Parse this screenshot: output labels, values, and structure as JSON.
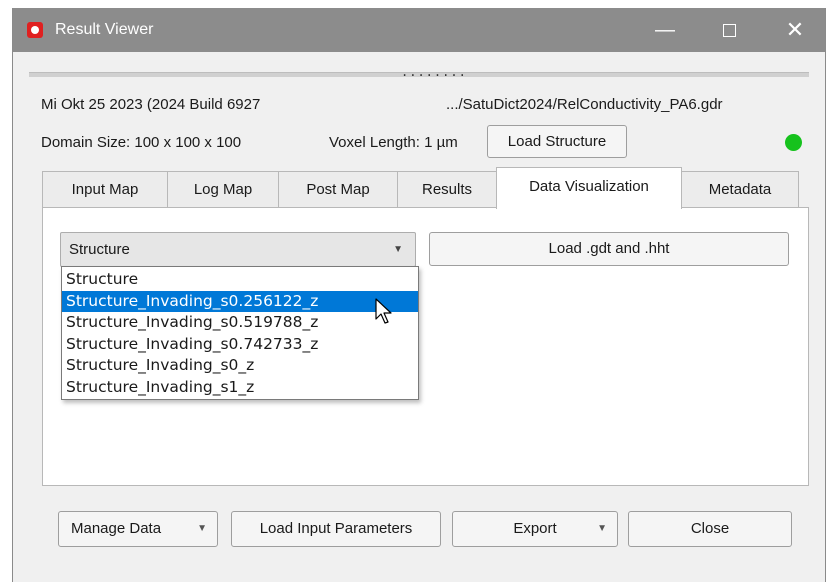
{
  "window": {
    "title": "Result Viewer",
    "controls": {
      "minimize": "—",
      "close": "✕"
    }
  },
  "info": {
    "build": "Mi Okt 25 2023 (2024 Build 6927",
    "file_path": ".../SatuDict2024/RelConductivity_PA6.gdr",
    "domain_size": "Domain Size: 100 x 100 x 100",
    "voxel_length": "Voxel Length: 1 µm",
    "load_structure_label": "Load Structure",
    "status_color": "#16c21d",
    "splitter_dots": "........"
  },
  "tabs": [
    {
      "label": "Input Map",
      "active": false
    },
    {
      "label": "Log Map",
      "active": false
    },
    {
      "label": "Post Map",
      "active": false
    },
    {
      "label": "Results",
      "active": false
    },
    {
      "label": "Data Visualization",
      "active": true
    },
    {
      "label": "Metadata",
      "active": false
    }
  ],
  "data_visualization": {
    "combo_value": "Structure",
    "load_button_label": "Load .gdt and .hht",
    "dropdown_options": [
      "Structure",
      "Structure_Invading_s0.256122_z",
      "Structure_Invading_s0.519788_z",
      "Structure_Invading_s0.742733_z",
      "Structure_Invading_s0_z",
      "Structure_Invading_s1_z"
    ],
    "highlighted_option": "Structure_Invading_s0.256122_z"
  },
  "footer": {
    "manage_data": "Manage Data",
    "load_input_parameters": "Load Input Parameters",
    "export": "Export",
    "close": "Close"
  },
  "colors": {
    "titlebar": "#8c8c8c",
    "selection": "#0078d7",
    "app_icon": "#e02020"
  }
}
